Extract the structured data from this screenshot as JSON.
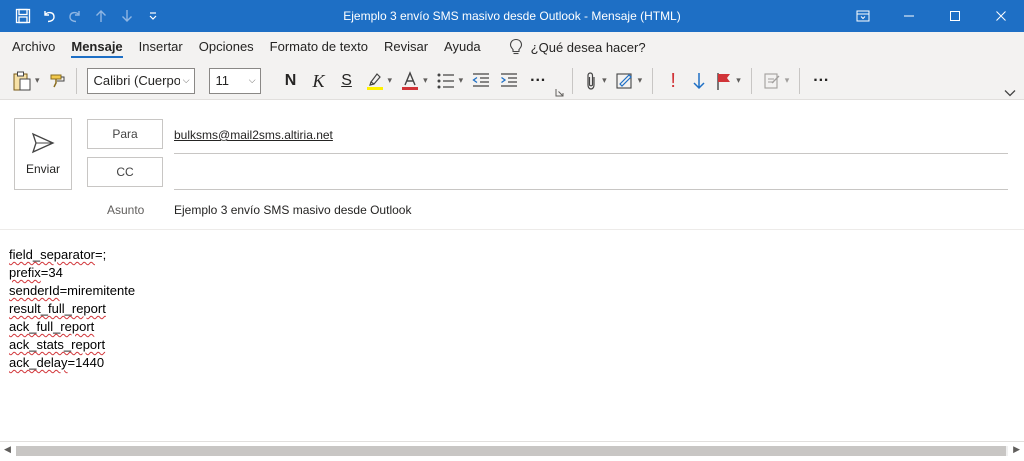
{
  "window": {
    "title": "Ejemplo 3 envío SMS masivo desde Outlook  -  Mensaje (HTML)"
  },
  "menu": {
    "tabs": [
      "Archivo",
      "Mensaje",
      "Insertar",
      "Opciones",
      "Formato de texto",
      "Revisar",
      "Ayuda"
    ],
    "active_tab": "Mensaje",
    "tell_me": "¿Qué desea hacer?"
  },
  "ribbon": {
    "font_name": "Calibri (Cuerpo",
    "font_size": "11",
    "bold": "N",
    "italic": "K",
    "strike": "S",
    "more": "···",
    "importance_high": "!"
  },
  "compose": {
    "send_label": "Enviar",
    "to_label": "Para",
    "cc_label": "CC",
    "subject_label": "Asunto",
    "to_value": "bulksms@mail2sms.altiria.net",
    "cc_value": "",
    "subject_value": "Ejemplo 3 envío SMS masivo desde Outlook"
  },
  "body_lines": [
    {
      "key": "field_separator",
      "rest": "=;"
    },
    {
      "key": "prefix",
      "rest": "=34"
    },
    {
      "key": "senderId",
      "rest": "=miremitente"
    },
    {
      "key": "result_full_report",
      "rest": ""
    },
    {
      "key": "ack_full_report",
      "rest": ""
    },
    {
      "key": "ack_stats_report",
      "rest": ""
    },
    {
      "key": "ack_delay",
      "rest": "=1440"
    }
  ],
  "colors": {
    "titlebar": "#1e6fc5",
    "accent": "#1e6fc5",
    "spellcheck": "#d13438"
  }
}
